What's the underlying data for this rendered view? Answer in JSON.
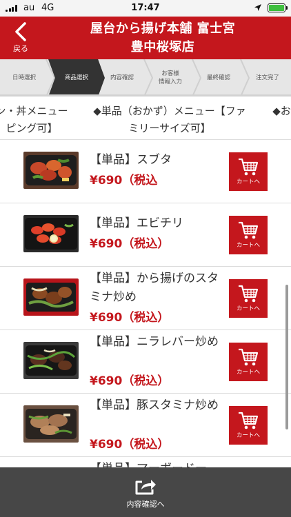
{
  "status_bar": {
    "carrier": "au",
    "network": "4G",
    "time": "17:47"
  },
  "header": {
    "back_label": "戻る",
    "title_line1": "屋台から揚げ本舗 富士宮",
    "title_line2": "豊中桜塚店"
  },
  "steps": [
    {
      "label": "日時選択"
    },
    {
      "label": "商品選択"
    },
    {
      "label": "内容確認"
    },
    {
      "label": "お客様\n情報入力"
    },
    {
      "label": "最終確認"
    },
    {
      "label": "注文完了"
    }
  ],
  "tabs": [
    {
      "label": "ン・丼メニュー\nピング可】"
    },
    {
      "label": "◆単品（おかず）メニュー【ファ\nミリーサイズ可】"
    },
    {
      "label": "◆お得"
    }
  ],
  "products": [
    {
      "name": "【単品】スブタ",
      "price": "¥690（税込",
      "cart_label": "カートへ"
    },
    {
      "name": "【単品】エビチリ",
      "price": "¥690（税込）",
      "cart_label": "カートへ"
    },
    {
      "name": "【単品】から揚げのスタミナ炒め",
      "price": "¥690（税込）",
      "cart_label": "カートへ"
    },
    {
      "name": "【単品】ニラレバー炒め",
      "price": "¥690（税込）",
      "cart_label": "カートへ"
    },
    {
      "name": "【単品】豚スタミナ炒め",
      "price": "¥690（税込）",
      "cart_label": "カートへ"
    },
    {
      "name": "【単品】マーボードー",
      "price": "",
      "cart_label": ""
    }
  ],
  "bottom_bar": {
    "label": "内容確認へ"
  },
  "colors": {
    "brand_red": "#c4171d",
    "active_step": "#333333",
    "bottom_bar": "#474747"
  },
  "icons": [
    "back-chevron-icon",
    "cart-icon",
    "share-icon",
    "location-arrow-icon",
    "battery-icon"
  ]
}
